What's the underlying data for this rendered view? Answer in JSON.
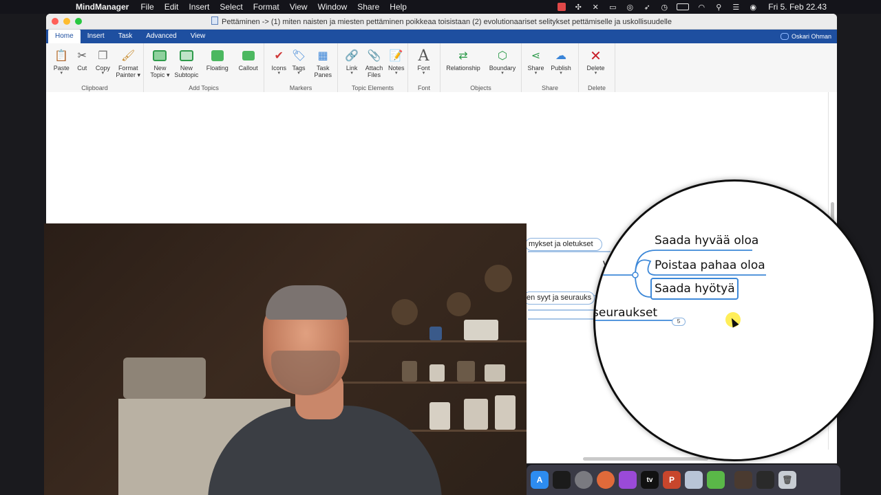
{
  "menubar": {
    "apple_icon": "apple-icon",
    "app_name": "MindManager",
    "items": [
      "File",
      "Edit",
      "Insert",
      "Select",
      "Format",
      "View",
      "Window",
      "Share",
      "Help"
    ],
    "clock": "Fri 5. Feb  22.43"
  },
  "window": {
    "title": "Pettäminen -> (1) miten naisten ja miesten pettäminen poikkeaa toisistaan (2) evolutionaariset selitykset pettämiselle ja uskollisuudelle",
    "user": "Oskari Ohman"
  },
  "tabs": [
    "Home",
    "Insert",
    "Task",
    "Advanced",
    "View"
  ],
  "ribbon": {
    "clipboard": {
      "label": "Clipboard",
      "paste": "Paste",
      "cut": "Cut",
      "copy": "Copy",
      "format_painter_1": "Format",
      "format_painter_2": "Painter"
    },
    "add_topics": {
      "label": "Add Topics",
      "new_topic_1": "New",
      "new_topic_2": "Topic",
      "new_subtopic_1": "New",
      "new_subtopic_2": "Subtopic",
      "floating": "Floating",
      "callout": "Callout"
    },
    "markers": {
      "label": "Markers",
      "icons": "Icons",
      "tags": "Tags",
      "task_panes_1": "Task",
      "task_panes_2": "Panes"
    },
    "topic_elements": {
      "label": "Topic Elements",
      "link": "Link",
      "attach_1": "Attach",
      "attach_2": "Files",
      "notes": "Notes"
    },
    "font": {
      "label": "Font",
      "font": "Font"
    },
    "objects": {
      "label": "Objects",
      "relationship": "Relationship",
      "boundary": "Boundary"
    },
    "share": {
      "label": "Share",
      "share": "Share",
      "publish": "Publish"
    },
    "delete": {
      "label": "Delete",
      "delete": "Delete"
    }
  },
  "mindmap": {
    "node_1": "mykset ja oletukset",
    "node_2": "yt",
    "node_3": "en syyt ja seurauks",
    "magnified": {
      "topic_1": "Saada hyvää oloa",
      "topic_2": "Poistaa pahaa oloa",
      "topic_3": "Saada hyötyä",
      "parent": "seuraukset",
      "badge": "5"
    }
  },
  "dock": {
    "icons": [
      "app-store-icon",
      "kindle-icon",
      "settings-icon",
      "rocket-icon",
      "podcasts-icon",
      "apple-tv-icon",
      "powerpoint-icon",
      "screenshot-icon",
      "mindmanager-icon",
      "video-thumbnail-icon",
      "terminal-icon",
      "trash-icon"
    ],
    "labels": [
      "A",
      "",
      "",
      "",
      "",
      "tv",
      "P",
      "",
      "",
      "",
      "",
      ""
    ]
  },
  "colors": {
    "ribbon_blue": "#1e4fa0",
    "selection": "#3d88d8",
    "close": "#ff5f57",
    "minimize": "#febc2e",
    "maximize": "#28c840"
  }
}
